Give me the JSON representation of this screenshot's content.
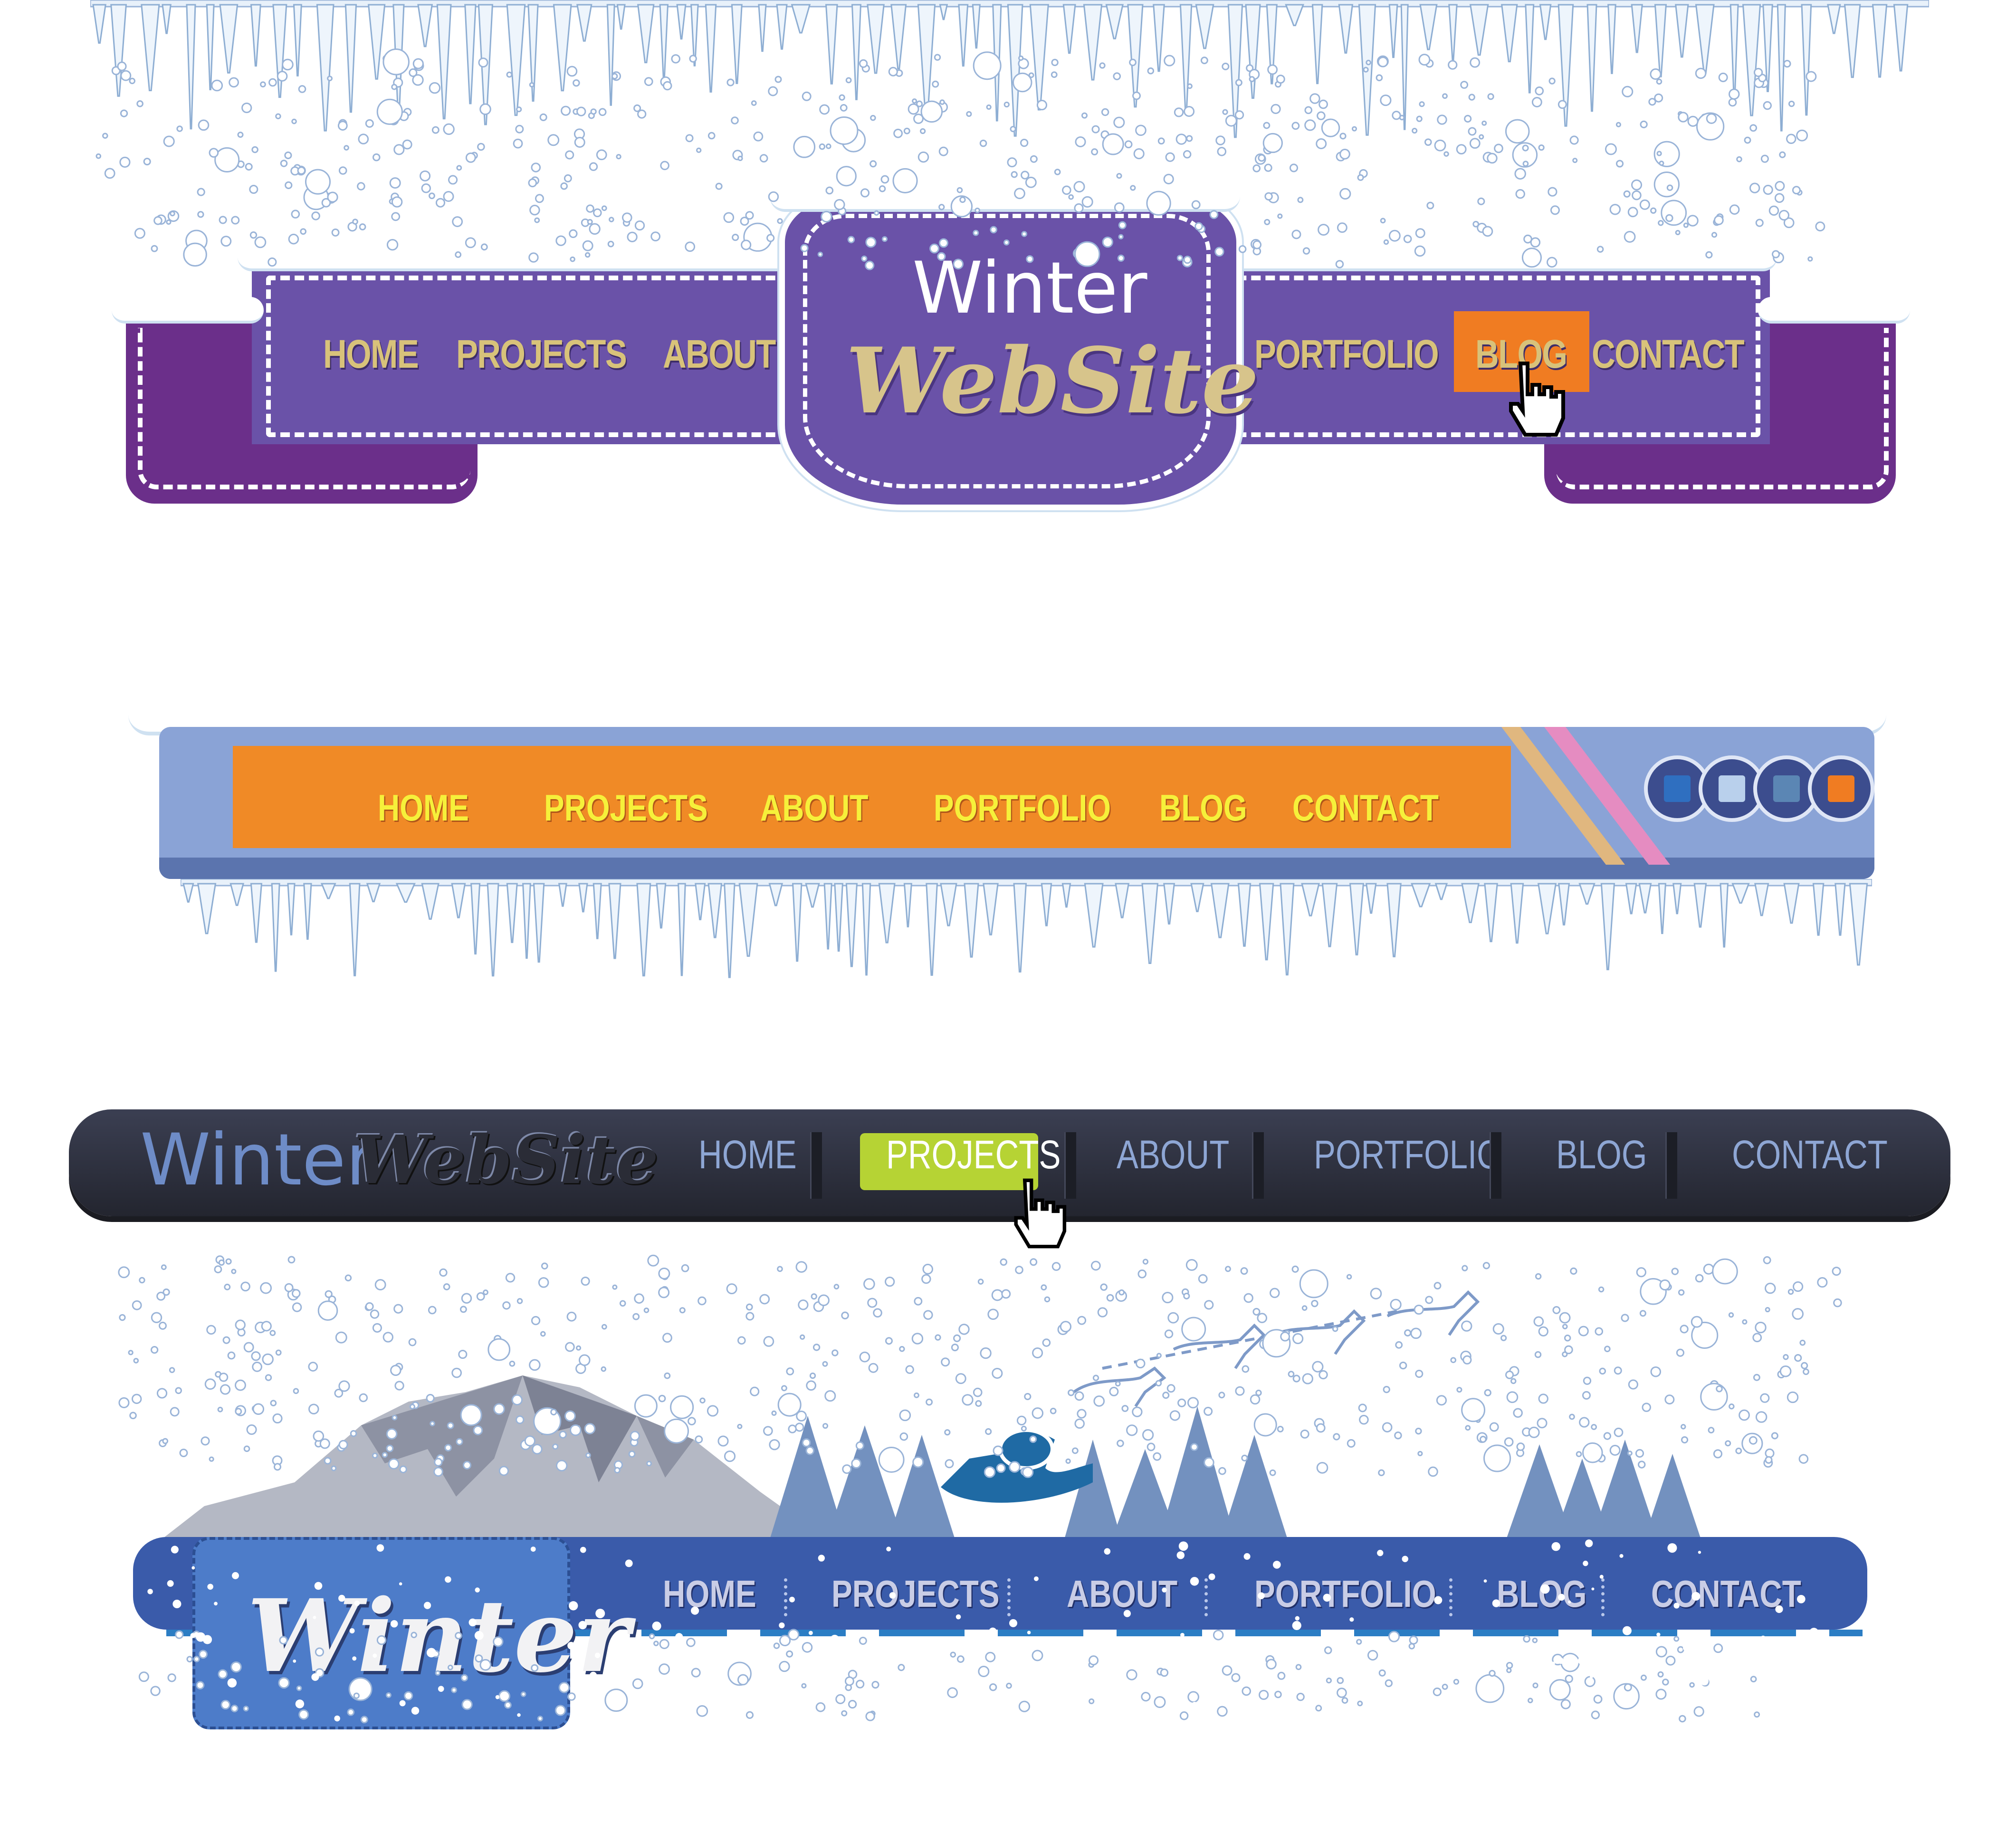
{
  "colors": {
    "purple_wing": "#6b2f8a",
    "purple_band": "#6a52a8",
    "gold_text": "#d8c27a",
    "orange_active": "#f07c22",
    "orange_bar": "#f08a26",
    "yellow_text": "#f6f03a",
    "dark_bar": "#2b2e3b",
    "green_active": "#b6d334",
    "blue_bar": "#3a5baa"
  },
  "header1": {
    "logo_line1": "Winter",
    "logo_line2": "WebSite",
    "nav": [
      "HOME",
      "PROJECTS",
      "ABOUT",
      "PORTFOLIO",
      "BLOG",
      "CONTACT"
    ],
    "active": "BLOG",
    "cursor_icon": "hand-pointer-icon"
  },
  "header2": {
    "nav": [
      "HOME",
      "PROJECTS",
      "ABOUT",
      "PORTFOLIO",
      "BLOG",
      "CONTACT"
    ],
    "round_buttons": [
      {
        "icon": "square-icon",
        "color": "#2f6fc0"
      },
      {
        "icon": "square-icon",
        "color": "#b9d0ec"
      },
      {
        "icon": "square-icon",
        "color": "#5b86b4"
      },
      {
        "icon": "square-icon",
        "color": "#f07c22"
      }
    ]
  },
  "header3": {
    "logo_line1": "Winter",
    "logo_line2": "WebSite",
    "nav": [
      "HOME",
      "PROJECTS",
      "ABOUT",
      "PORTFOLIO",
      "BLOG",
      "CONTACT"
    ],
    "active": "PROJECTS",
    "cursor_icon": "hand-pointer-icon"
  },
  "header4": {
    "logo": "Winter",
    "nav": [
      "HOME",
      "PROJECTS",
      "ABOUT",
      "PORTFOLIO",
      "BLOG",
      "CONTACT"
    ],
    "scene_icons": [
      "mountain-icon",
      "pine-tree-icon",
      "santa-sleigh-icon",
      "reindeer-icon"
    ]
  }
}
